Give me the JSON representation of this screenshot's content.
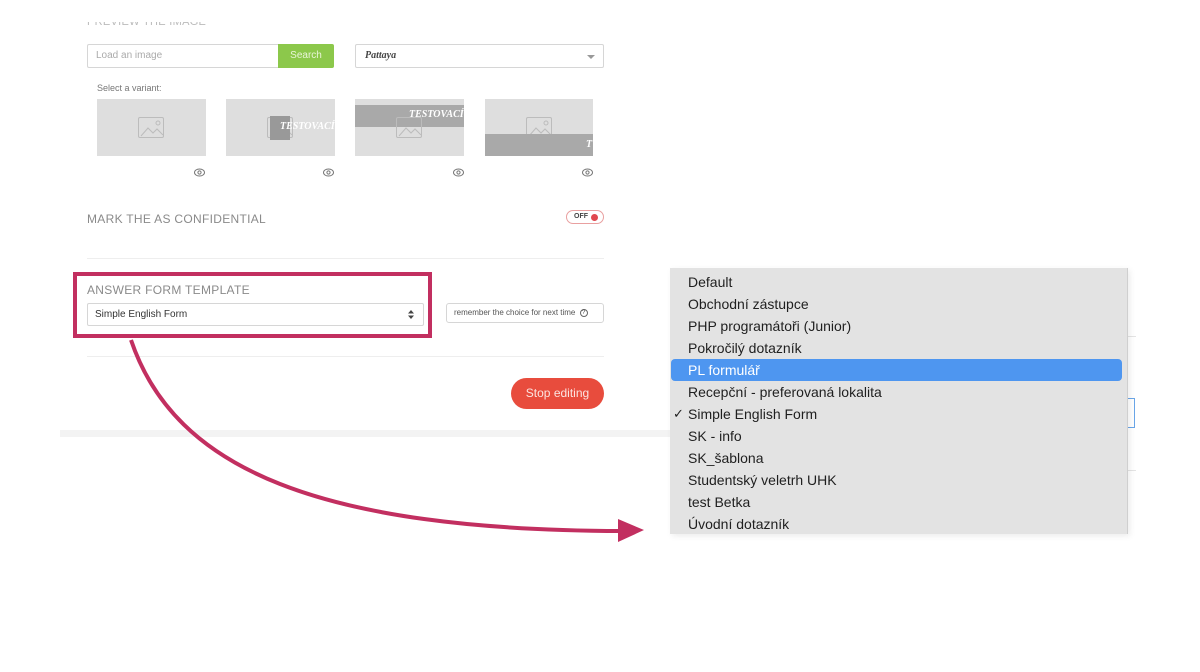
{
  "page": {
    "preview_heading": "PREVIEW THE IMAGE",
    "image_search": {
      "placeholder": "Load an image",
      "button_label": "Search"
    },
    "font_select": {
      "value": "Pattaya"
    },
    "variant_label": "Select a variant:",
    "variants": [
      {
        "name": "variant-1",
        "overlay_text": ""
      },
      {
        "name": "variant-2",
        "overlay_text": "TESTOVACÍ P"
      },
      {
        "name": "variant-3",
        "overlay_text": "TESTOVACÍ P"
      },
      {
        "name": "variant-4",
        "overlay_text": "T"
      }
    ],
    "confidential": {
      "label": "MARK THE AS CONFIDENTIAL",
      "toggle_state": "OFF"
    },
    "answer_form": {
      "label": "ANSWER FORM TEMPLATE",
      "selected": "Simple English Form",
      "remember_label": "remember the choice for next time",
      "help_glyph": "?"
    },
    "stop_button": "Stop editing"
  },
  "dropdown": {
    "options": [
      {
        "label": "Default",
        "checked": false,
        "highlighted": false
      },
      {
        "label": "Obchodní zástupce",
        "checked": false,
        "highlighted": false
      },
      {
        "label": "PHP programátoři (Junior)",
        "checked": false,
        "highlighted": false
      },
      {
        "label": "Pokročilý dotazník",
        "checked": false,
        "highlighted": false
      },
      {
        "label": "PL formulář",
        "checked": false,
        "highlighted": true
      },
      {
        "label": "Recepční - preferovaná lokalita",
        "checked": false,
        "highlighted": false
      },
      {
        "label": "Simple English Form",
        "checked": true,
        "highlighted": false
      },
      {
        "label": "SK - info",
        "checked": false,
        "highlighted": false
      },
      {
        "label": "SK_šablona",
        "checked": false,
        "highlighted": false
      },
      {
        "label": "Studentský veletrh UHK",
        "checked": false,
        "highlighted": false
      },
      {
        "label": "test Betka",
        "checked": false,
        "highlighted": false
      },
      {
        "label": "Úvodní dotazník",
        "checked": false,
        "highlighted": false
      }
    ],
    "check_glyph": "✓"
  },
  "colors": {
    "annotation": "#c22f60",
    "search_button": "#8cc84b",
    "stop_button": "#e84c3d",
    "highlight": "#4e96f0"
  }
}
